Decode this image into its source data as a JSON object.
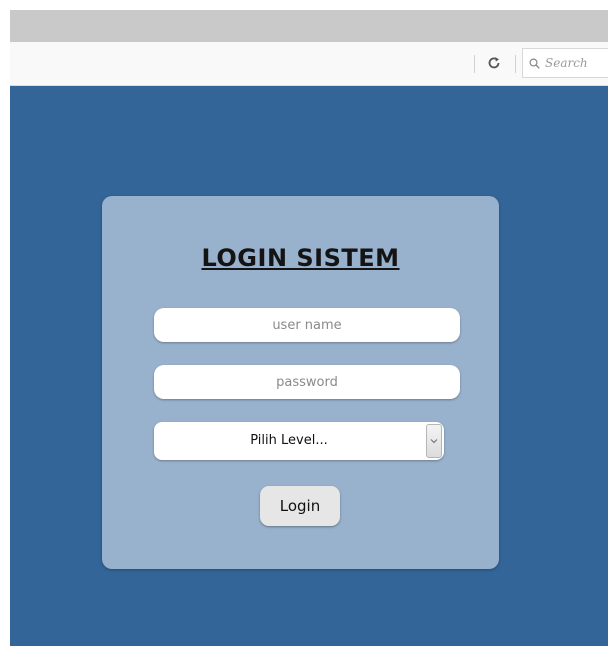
{
  "browser": {
    "search_placeholder": "Search",
    "tabstrip_color": "#c9c9c9",
    "navbar_color": "#f9f9f9",
    "icons": [
      "reload-icon",
      "search-icon"
    ]
  },
  "page": {
    "background_color": "#336598",
    "card_color": "#98b1cc"
  },
  "login": {
    "title": "LOGIN SISTEM",
    "username_placeholder": "user name",
    "username_value": "",
    "password_placeholder": "password",
    "password_value": "",
    "level_selected": "Pilih Level...",
    "login_button_label": "Login"
  }
}
